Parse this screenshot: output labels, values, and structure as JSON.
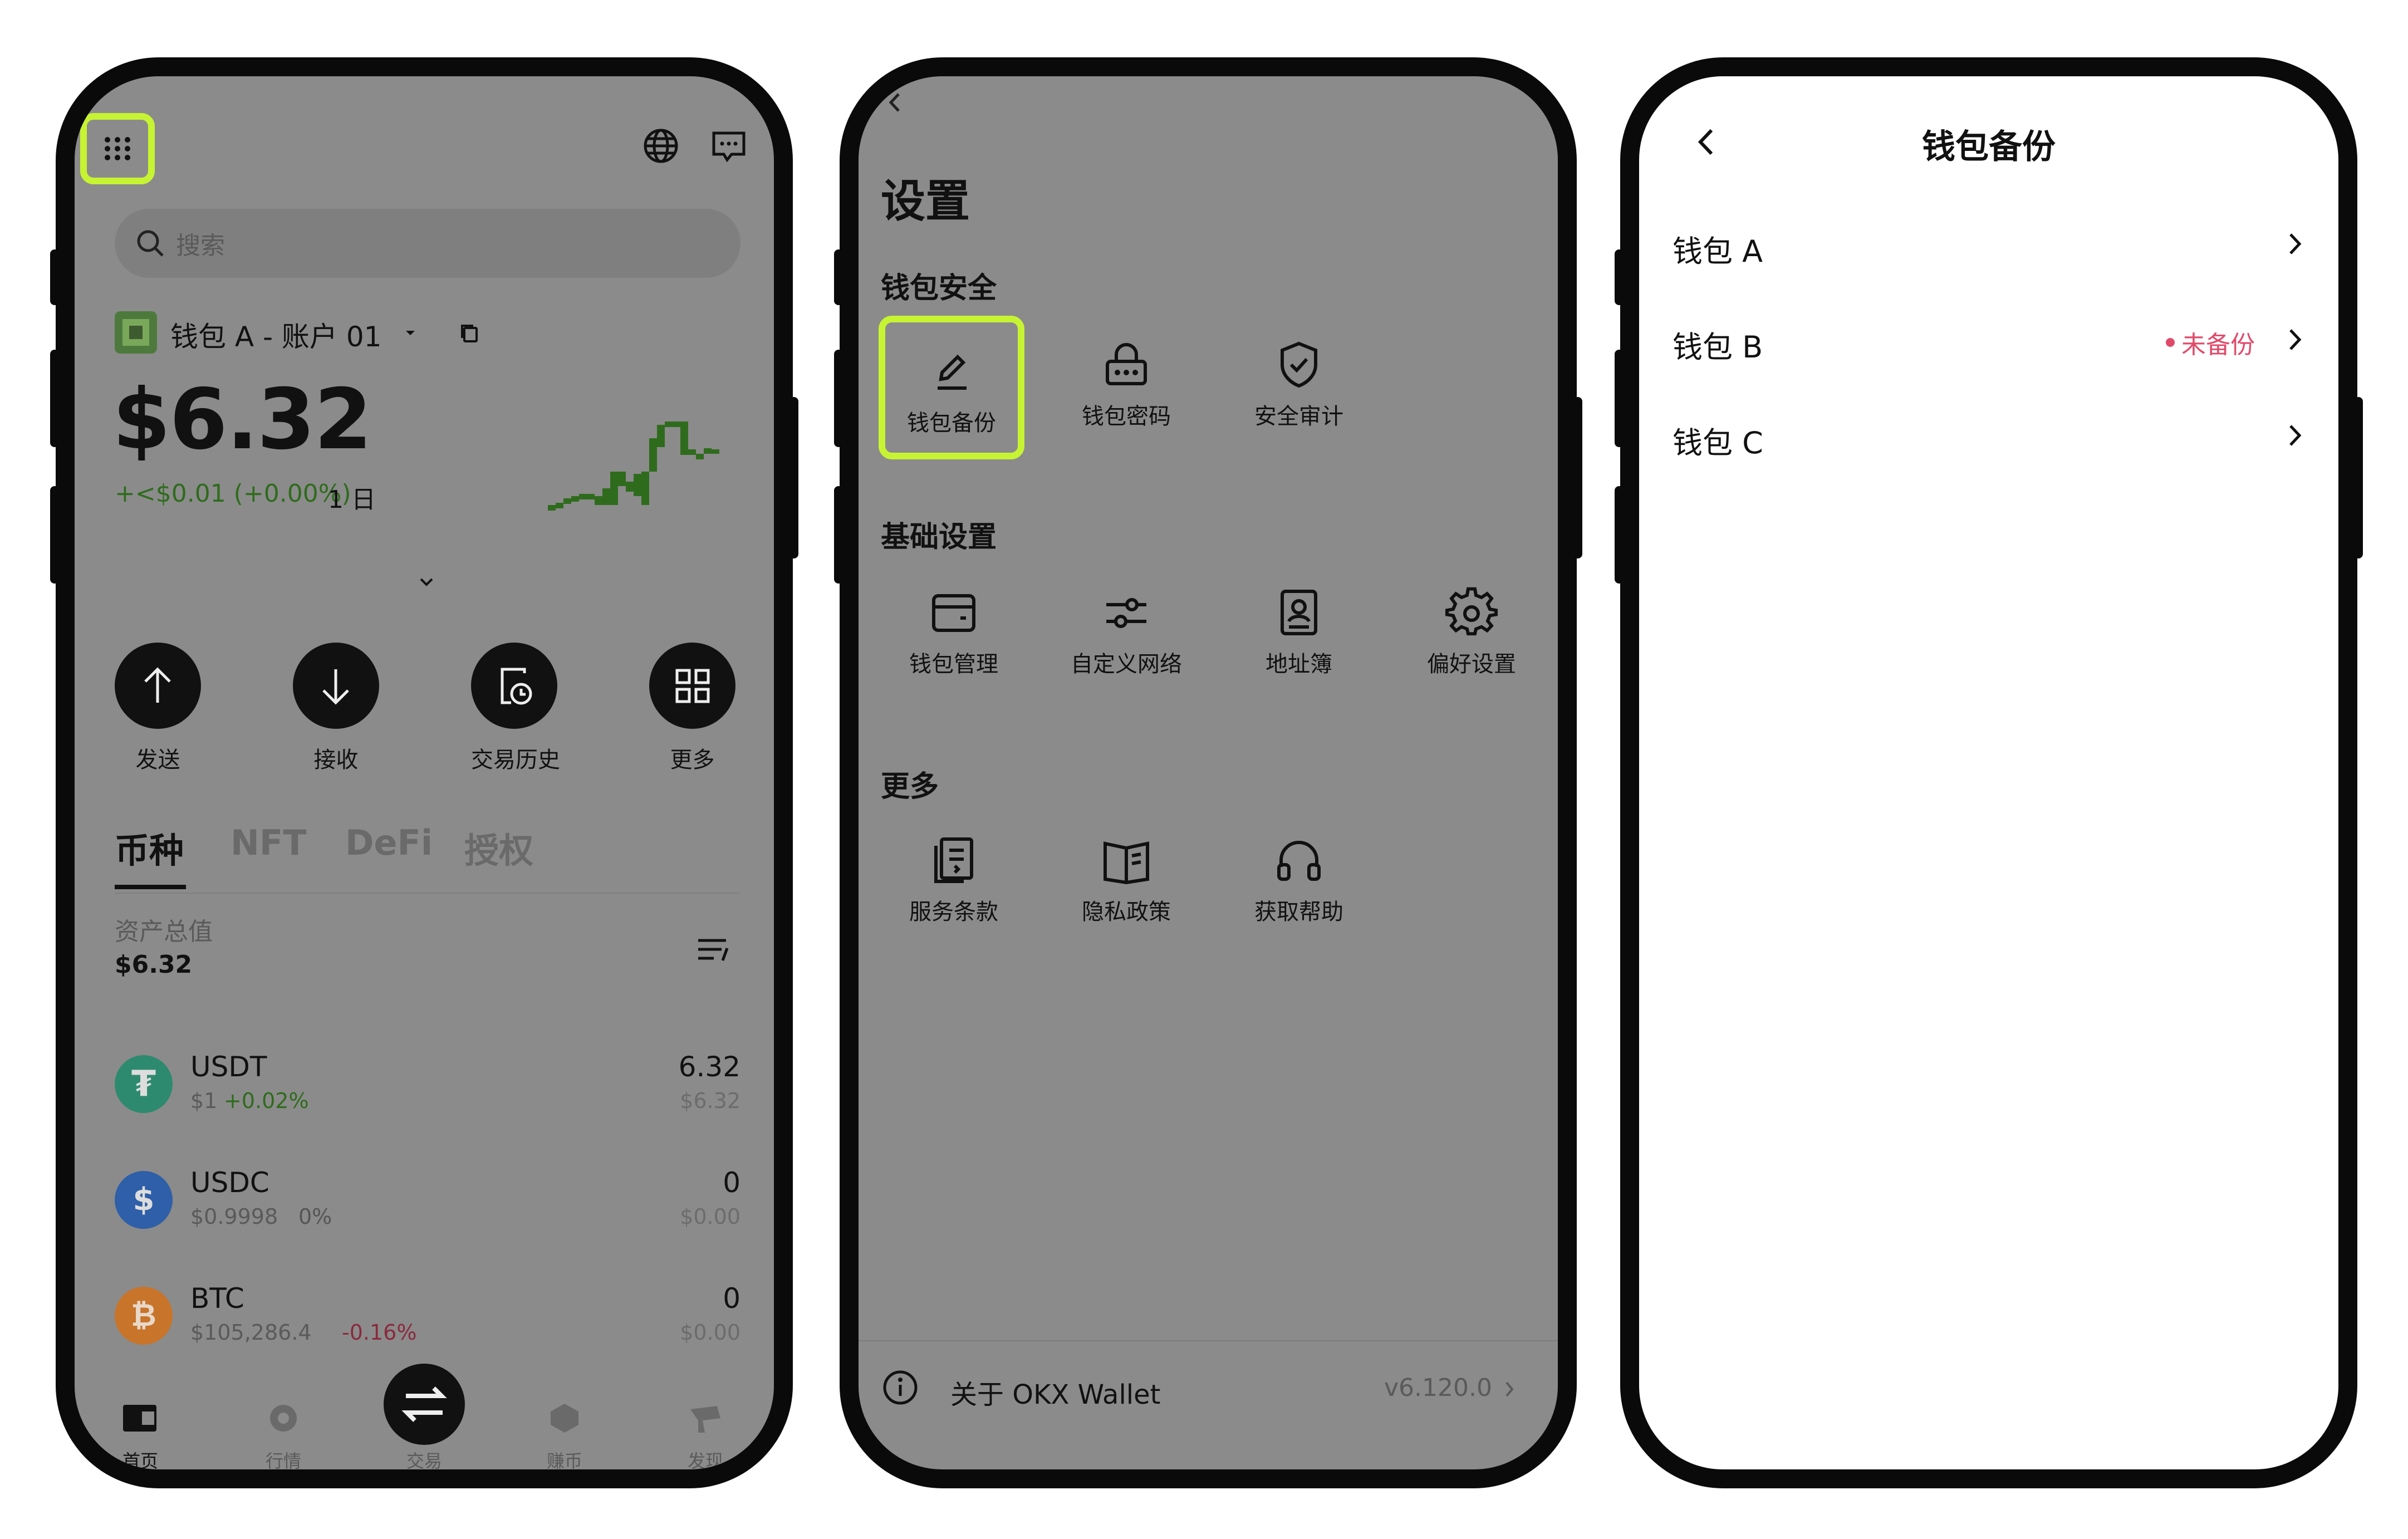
{
  "phone1": {
    "search_placeholder": "搜索",
    "wallet_name": "钱包 A - 账户 01",
    "balance": "$6.32",
    "change": "+<$0.01 (+0.00%)",
    "period": "1 日",
    "actions": [
      {
        "label": "发送",
        "icon": "arrow-up-icon"
      },
      {
        "label": "接收",
        "icon": "arrow-down-icon"
      },
      {
        "label": "交易历史",
        "icon": "history-icon"
      },
      {
        "label": "更多",
        "icon": "grid-icon"
      }
    ],
    "tabs": [
      "币种",
      "NFT",
      "DeFi",
      "授权"
    ],
    "total_label": "资产总值",
    "total_value": "$6.32",
    "tokens": [
      {
        "name": "USDT",
        "price": "$1",
        "change": "+0.02%",
        "amount": "6.32",
        "value": "$6.32",
        "color": "#2e8a6e",
        "change_color": "#2f6b1d"
      },
      {
        "name": "USDC",
        "price": "$0.9998",
        "change": "0%",
        "amount": "0",
        "value": "$0.00",
        "color": "#2e5fa8",
        "change_color": "#555555"
      },
      {
        "name": "BTC",
        "price": "$105,286.4",
        "change": "-0.16%",
        "amount": "0",
        "value": "$0.00",
        "color": "#c8742a",
        "change_color": "#8a2a3e"
      }
    ],
    "bottom_nav": [
      "首页",
      "行情",
      "交易",
      "赚币",
      "发现"
    ],
    "colors": {
      "highlight": "#c6f432",
      "positive": "#2f6b1d"
    }
  },
  "phone2": {
    "title": "设置",
    "sections": [
      {
        "title": "钱包安全",
        "items": [
          {
            "label": "钱包备份",
            "icon": "pencil-icon"
          },
          {
            "label": "钱包密码",
            "icon": "password-lock-icon"
          },
          {
            "label": "安全审计",
            "icon": "shield-check-icon"
          }
        ]
      },
      {
        "title": "基础设置",
        "items": [
          {
            "label": "钱包管理",
            "icon": "wallet-icon"
          },
          {
            "label": "自定义网络",
            "icon": "sliders-icon"
          },
          {
            "label": "地址簿",
            "icon": "address-book-icon"
          },
          {
            "label": "偏好设置",
            "icon": "gear-icon"
          }
        ]
      },
      {
        "title": "更多",
        "items": [
          {
            "label": "服务条款",
            "icon": "document-icon"
          },
          {
            "label": "隐私政策",
            "icon": "book-icon"
          },
          {
            "label": "获取帮助",
            "icon": "headset-icon"
          }
        ]
      }
    ],
    "about_label": "关于 OKX Wallet",
    "version": "v6.120.0"
  },
  "phone3": {
    "title": "钱包备份",
    "wallets": [
      {
        "name": "钱包 A",
        "status": ""
      },
      {
        "name": "钱包 B",
        "status": "未备份"
      },
      {
        "name": "钱包 C",
        "status": ""
      }
    ],
    "colors": {
      "warning": "#e04a6a"
    }
  }
}
